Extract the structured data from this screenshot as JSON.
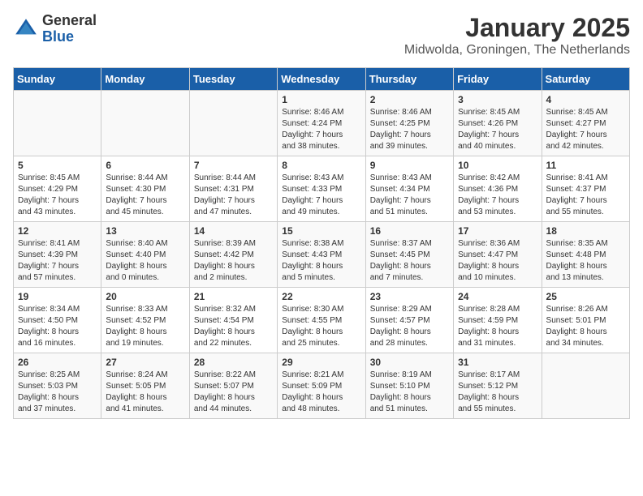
{
  "logo": {
    "general": "General",
    "blue": "Blue"
  },
  "header": {
    "month": "January 2025",
    "location": "Midwolda, Groningen, The Netherlands"
  },
  "weekdays": [
    "Sunday",
    "Monday",
    "Tuesday",
    "Wednesday",
    "Thursday",
    "Friday",
    "Saturday"
  ],
  "weeks": [
    [
      {
        "day": "",
        "info": ""
      },
      {
        "day": "",
        "info": ""
      },
      {
        "day": "",
        "info": ""
      },
      {
        "day": "1",
        "info": "Sunrise: 8:46 AM\nSunset: 4:24 PM\nDaylight: 7 hours\nand 38 minutes."
      },
      {
        "day": "2",
        "info": "Sunrise: 8:46 AM\nSunset: 4:25 PM\nDaylight: 7 hours\nand 39 minutes."
      },
      {
        "day": "3",
        "info": "Sunrise: 8:45 AM\nSunset: 4:26 PM\nDaylight: 7 hours\nand 40 minutes."
      },
      {
        "day": "4",
        "info": "Sunrise: 8:45 AM\nSunset: 4:27 PM\nDaylight: 7 hours\nand 42 minutes."
      }
    ],
    [
      {
        "day": "5",
        "info": "Sunrise: 8:45 AM\nSunset: 4:29 PM\nDaylight: 7 hours\nand 43 minutes."
      },
      {
        "day": "6",
        "info": "Sunrise: 8:44 AM\nSunset: 4:30 PM\nDaylight: 7 hours\nand 45 minutes."
      },
      {
        "day": "7",
        "info": "Sunrise: 8:44 AM\nSunset: 4:31 PM\nDaylight: 7 hours\nand 47 minutes."
      },
      {
        "day": "8",
        "info": "Sunrise: 8:43 AM\nSunset: 4:33 PM\nDaylight: 7 hours\nand 49 minutes."
      },
      {
        "day": "9",
        "info": "Sunrise: 8:43 AM\nSunset: 4:34 PM\nDaylight: 7 hours\nand 51 minutes."
      },
      {
        "day": "10",
        "info": "Sunrise: 8:42 AM\nSunset: 4:36 PM\nDaylight: 7 hours\nand 53 minutes."
      },
      {
        "day": "11",
        "info": "Sunrise: 8:41 AM\nSunset: 4:37 PM\nDaylight: 7 hours\nand 55 minutes."
      }
    ],
    [
      {
        "day": "12",
        "info": "Sunrise: 8:41 AM\nSunset: 4:39 PM\nDaylight: 7 hours\nand 57 minutes."
      },
      {
        "day": "13",
        "info": "Sunrise: 8:40 AM\nSunset: 4:40 PM\nDaylight: 8 hours\nand 0 minutes."
      },
      {
        "day": "14",
        "info": "Sunrise: 8:39 AM\nSunset: 4:42 PM\nDaylight: 8 hours\nand 2 minutes."
      },
      {
        "day": "15",
        "info": "Sunrise: 8:38 AM\nSunset: 4:43 PM\nDaylight: 8 hours\nand 5 minutes."
      },
      {
        "day": "16",
        "info": "Sunrise: 8:37 AM\nSunset: 4:45 PM\nDaylight: 8 hours\nand 7 minutes."
      },
      {
        "day": "17",
        "info": "Sunrise: 8:36 AM\nSunset: 4:47 PM\nDaylight: 8 hours\nand 10 minutes."
      },
      {
        "day": "18",
        "info": "Sunrise: 8:35 AM\nSunset: 4:48 PM\nDaylight: 8 hours\nand 13 minutes."
      }
    ],
    [
      {
        "day": "19",
        "info": "Sunrise: 8:34 AM\nSunset: 4:50 PM\nDaylight: 8 hours\nand 16 minutes."
      },
      {
        "day": "20",
        "info": "Sunrise: 8:33 AM\nSunset: 4:52 PM\nDaylight: 8 hours\nand 19 minutes."
      },
      {
        "day": "21",
        "info": "Sunrise: 8:32 AM\nSunset: 4:54 PM\nDaylight: 8 hours\nand 22 minutes."
      },
      {
        "day": "22",
        "info": "Sunrise: 8:30 AM\nSunset: 4:55 PM\nDaylight: 8 hours\nand 25 minutes."
      },
      {
        "day": "23",
        "info": "Sunrise: 8:29 AM\nSunset: 4:57 PM\nDaylight: 8 hours\nand 28 minutes."
      },
      {
        "day": "24",
        "info": "Sunrise: 8:28 AM\nSunset: 4:59 PM\nDaylight: 8 hours\nand 31 minutes."
      },
      {
        "day": "25",
        "info": "Sunrise: 8:26 AM\nSunset: 5:01 PM\nDaylight: 8 hours\nand 34 minutes."
      }
    ],
    [
      {
        "day": "26",
        "info": "Sunrise: 8:25 AM\nSunset: 5:03 PM\nDaylight: 8 hours\nand 37 minutes."
      },
      {
        "day": "27",
        "info": "Sunrise: 8:24 AM\nSunset: 5:05 PM\nDaylight: 8 hours\nand 41 minutes."
      },
      {
        "day": "28",
        "info": "Sunrise: 8:22 AM\nSunset: 5:07 PM\nDaylight: 8 hours\nand 44 minutes."
      },
      {
        "day": "29",
        "info": "Sunrise: 8:21 AM\nSunset: 5:09 PM\nDaylight: 8 hours\nand 48 minutes."
      },
      {
        "day": "30",
        "info": "Sunrise: 8:19 AM\nSunset: 5:10 PM\nDaylight: 8 hours\nand 51 minutes."
      },
      {
        "day": "31",
        "info": "Sunrise: 8:17 AM\nSunset: 5:12 PM\nDaylight: 8 hours\nand 55 minutes."
      },
      {
        "day": "",
        "info": ""
      }
    ]
  ]
}
